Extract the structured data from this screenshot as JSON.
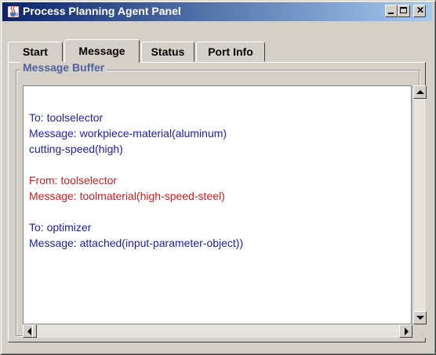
{
  "window": {
    "title": "Process Planning Agent Panel",
    "icon": "java-cup-icon",
    "controls": [
      "minimize",
      "maximize",
      "close"
    ]
  },
  "tabs": [
    {
      "label": "Start",
      "active": false
    },
    {
      "label": "Message",
      "active": true
    },
    {
      "label": "Status",
      "active": false
    },
    {
      "label": "Port Info",
      "active": false
    }
  ],
  "message_buffer": {
    "legend": "Message Buffer",
    "messages": [
      {
        "direction": "to",
        "header": "To: toolselector",
        "lines": [
          "Message: workpiece-material(aluminum)",
          "cutting-speed(high)"
        ],
        "color": "#2020a8"
      },
      {
        "direction": "from",
        "header": "From: toolselector",
        "lines": [
          "Message: toolmaterial(high-speed-steel)"
        ],
        "color": "#c82020"
      },
      {
        "direction": "to",
        "header": "To: optimizer",
        "lines": [
          "Message: attached(input-parameter-object))"
        ],
        "color": "#2020a8"
      }
    ]
  },
  "colors": {
    "titlebar_start": "#0a246a",
    "titlebar_end": "#a6caf0",
    "legend": "#4f5f9d"
  }
}
